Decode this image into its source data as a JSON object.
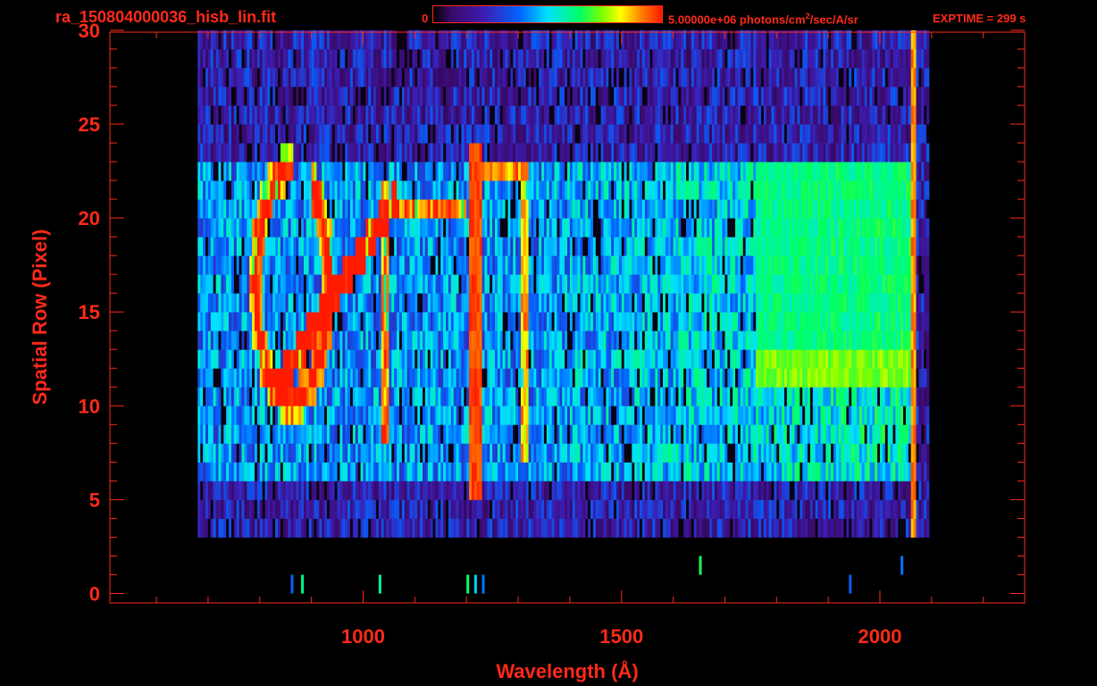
{
  "header": {
    "filename": "ra_150804000036_hisb_lin.fit",
    "colorbar_min": "0",
    "colorbar_max_prefix": "5.00000e+06 photons/cm",
    "colorbar_max_sup": "2",
    "colorbar_max_suffix": "/sec/A/sr",
    "exptime": "EXPTIME = 299 s"
  },
  "colors": {
    "axis": "#ff2a1a",
    "background": "#000000",
    "colormap": [
      "#000000",
      "#3a0a6a",
      "#3c1cb0",
      "#0066ff",
      "#00e0ff",
      "#00ff66",
      "#7fff00",
      "#ffff00",
      "#ff8000",
      "#ff1a00"
    ]
  },
  "chart_data": {
    "type": "heatmap",
    "xlabel": "Wavelength (Å)",
    "ylabel": "Spatial Row (Pixel)",
    "xlim": [
      510,
      2280
    ],
    "ylim": [
      -0.5,
      29.9
    ],
    "xticks": [
      1000,
      1500,
      2000
    ],
    "yticks": [
      0,
      5,
      10,
      15,
      20,
      25,
      30
    ],
    "colorbar_range": [
      0,
      5000000
    ],
    "colorbar_units": "photons/cm^2/sec/A/sr",
    "data_extent": {
      "x": [
        680,
        2095
      ],
      "y": [
        3,
        30
      ]
    },
    "features": [
      {
        "name": "emission line",
        "x": 1216,
        "y_range": [
          5,
          24
        ],
        "level": 0.95
      },
      {
        "name": "detector edge",
        "x": 2065,
        "y_range": [
          2,
          30
        ],
        "level": 0.85
      },
      {
        "name": "bright band",
        "x_range": [
          1760,
          2060
        ],
        "y_range": [
          11,
          23
        ],
        "level": 0.6
      },
      {
        "name": "arc feature",
        "x_range": [
          790,
          1060
        ],
        "y_range": [
          10,
          23
        ],
        "level": 0.8
      }
    ]
  }
}
